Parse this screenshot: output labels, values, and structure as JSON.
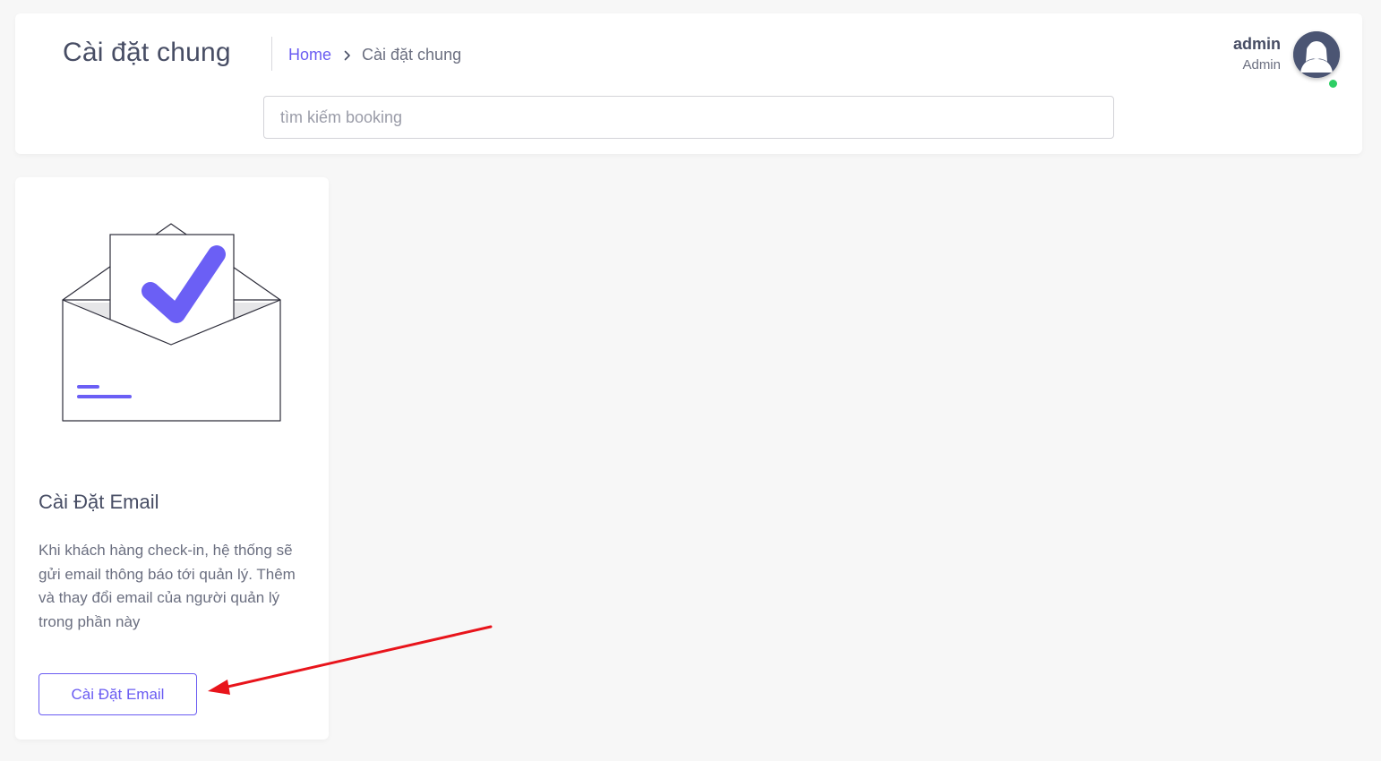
{
  "header": {
    "title": "Cài đặt chung",
    "breadcrumb": {
      "home": "Home",
      "current": "Cài đặt chung"
    },
    "search": {
      "placeholder": "tìm kiếm booking",
      "value": ""
    },
    "user": {
      "name": "admin",
      "role": "Admin",
      "status_color": "#2dce64"
    }
  },
  "card": {
    "icon": "email-check-illustration",
    "title": "Cài Đặt Email",
    "description": "Khi khách hàng check-in, hệ thống sẽ gửi email thông báo tới quản lý. Thêm và thay đổi email của người quản lý trong phần này",
    "button_label": "Cài Đặt Email"
  },
  "colors": {
    "accent": "#6a5cf2",
    "annotation": "#e8141b",
    "background": "#f7f7f7"
  }
}
